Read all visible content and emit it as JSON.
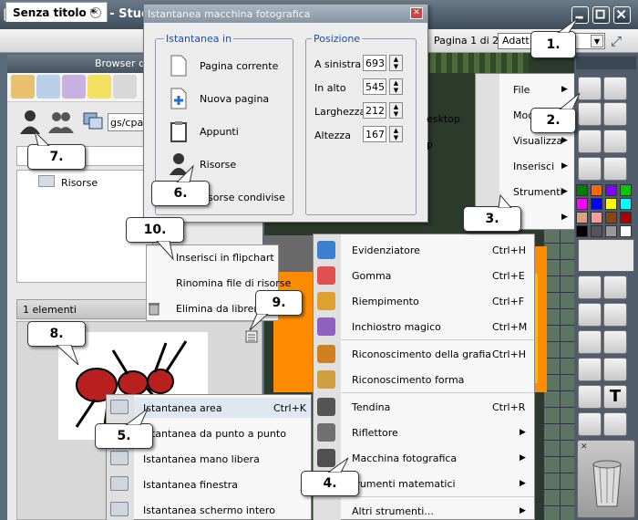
{
  "app": {
    "title": "ActivInspire - Studio",
    "colors": {
      "titlebar": "#46535f",
      "accent": "#1d4fa0",
      "orange": "#ff8c00"
    }
  },
  "tabbar": {
    "doc_tab": "Senza titolo *",
    "close_glyph": "✕",
    "page_label": "Pagina 1 di 2",
    "zoom_value": "Adatt",
    "dropdown_glyph": "▼",
    "fullscreen_glyph": "⤢"
  },
  "browser": {
    "title": "Browser de",
    "path": "gs/cpark",
    "tree_item": "Risorse",
    "elements_count": "1 elementi"
  },
  "snapshot_dialog": {
    "title": "Istantanea macchina fotografica",
    "close_glyph": "✕",
    "group_left_title": "Istantanea in",
    "group_right_title": "Posizione",
    "targets": [
      "Pagina corrente",
      "Nuova pagina",
      "Appunti",
      "Risorse",
      "isorse condivise"
    ],
    "position": [
      {
        "label": "A sinistra",
        "value": "693"
      },
      {
        "label": "In alto",
        "value": "545"
      },
      {
        "label": "Larghezza",
        "value": "212"
      },
      {
        "label": "Altezza",
        "value": "167"
      }
    ],
    "spin_glyphs": [
      "▲",
      "▼"
    ]
  },
  "resource_menu": {
    "items": [
      "Inserisci in flipchart",
      "Rinomina file di risorse",
      "Elimina da librer"
    ]
  },
  "main_menu": {
    "items": [
      "File",
      "Mod",
      "Visualizza",
      "Inserisci",
      "Strumenti"
    ],
    "arrow_glyph": "▶",
    "background_text": [
      "esktop",
      "p"
    ]
  },
  "tools_menu": {
    "items": [
      {
        "label": "Evidenziatore",
        "shortcut": "Ctrl+H",
        "icon": "highlighter-icon"
      },
      {
        "label": "Gomma",
        "shortcut": "Ctrl+E",
        "icon": "eraser-icon"
      },
      {
        "label": "Riempimento",
        "shortcut": "Ctrl+F",
        "icon": "fill-icon"
      },
      {
        "label": "Inchiostro magico",
        "shortcut": "Ctrl+M",
        "icon": "magic-ink-icon"
      },
      {
        "label": "Riconoscimento della grafia",
        "shortcut": "Ctrl+H",
        "icon": "handwriting-icon"
      },
      {
        "label": "Riconoscimento forma",
        "shortcut": "",
        "icon": "shape-recognition-icon"
      },
      {
        "label": "Tendina",
        "shortcut": "Ctrl+R",
        "icon": "curtain-icon"
      },
      {
        "label": "Riflettore",
        "shortcut": "",
        "icon": "spotlight-icon"
      },
      {
        "label": "Macchina fotografica",
        "shortcut": "",
        "icon": "camera-icon"
      },
      {
        "label": "trumenti matematici",
        "shortcut": "",
        "icon": "math-tools-icon"
      },
      {
        "label": "Altri strumenti...",
        "shortcut": "",
        "icon": ""
      }
    ]
  },
  "snapshot_submenu": {
    "items": [
      {
        "label": "Istantanea area",
        "shortcut": "Ctrl+K"
      },
      {
        "label": "Istantanea da punto a punto",
        "shortcut": ""
      },
      {
        "label": "Istantanea mano libera",
        "shortcut": ""
      },
      {
        "label": "Istantanea finestra",
        "shortcut": ""
      },
      {
        "label": "Istantanea schermo intero",
        "shortcut": ""
      }
    ]
  },
  "callouts": {
    "c1": "1.",
    "c2": "2.",
    "c3": "3.",
    "c4": "4.",
    "c5": "5.",
    "c6": "6.",
    "c7": "7.",
    "c8": "8.",
    "c9": "9.",
    "c10": "10."
  },
  "toolbox": {
    "swatches": [
      "#008000",
      "#ff6600",
      "#8000ff",
      "#00cc00",
      "#ff00ff",
      "#0000ff",
      "#ffff00",
      "#00ffff",
      "#e0a080",
      "#ff9999",
      "#8b4513",
      "#aa0000",
      "#000000",
      "#555555",
      "#999999",
      "#ffffff"
    ],
    "text_tool_glyph": "T",
    "close_glyph": "✕"
  }
}
